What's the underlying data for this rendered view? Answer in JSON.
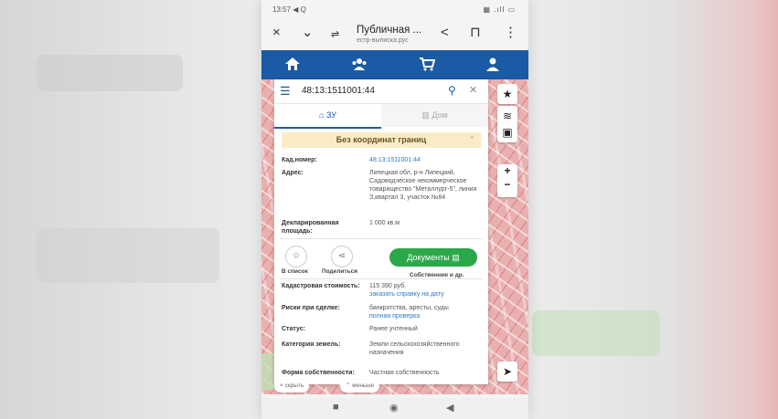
{
  "status_bar": {
    "time": "13:57 ◀ Q",
    "indicators": "▦ .ıll ▭"
  },
  "browser": {
    "close_icon": "×",
    "chevron_icon": "⌄",
    "tabs_icon": "⇌",
    "title": "Публичная ...",
    "url": "естр-выписка.рус",
    "share_icon": "<",
    "bookmark_icon": "⊓",
    "menu_icon": "⋮"
  },
  "nav": {
    "items": [
      "home-icon",
      "users-icon",
      "cart-icon",
      "profile-icon"
    ]
  },
  "search": {
    "value": "48:13:1511001:44"
  },
  "tabs": {
    "zu": "ЗУ",
    "dom": "Дом"
  },
  "alert": {
    "text": "Без координат границ"
  },
  "details": {
    "kad_label": "Кад.номер:",
    "kad_value": "48:13:1511001:44",
    "address_label": "Адрес:",
    "address_value": "Липецкая обл, р-н Липецкий, Садоводческое некоммерческое товарищество \"Металлург-5\", линия З,квартал 3, участок №84",
    "area_label": "Декларированная площадь:",
    "area_value": "1 000 кв.м"
  },
  "actions": {
    "in_list": "В список",
    "share": "Поделиться",
    "documents": "Документы",
    "owner": "Собственник и др."
  },
  "more": {
    "cost_label": "Кадастровая стоимость:",
    "cost_value": "115 390 руб.",
    "cost_link": "заказать справку на дату",
    "risks_label": "Риски при сделке:",
    "risks_value": "банкротства, аресты, суды",
    "risks_link": "полная проверка",
    "status_label": "Статус:",
    "status_value": "Ранее учтенный",
    "category_label": "Категория земель:",
    "category_value": "Земли сельскохозяйственного назначения",
    "form_label": "Форма собственности:",
    "form_value": "Частная собственность"
  },
  "bottom": {
    "hide": "× скрыть",
    "less": "⌃ меньше"
  }
}
